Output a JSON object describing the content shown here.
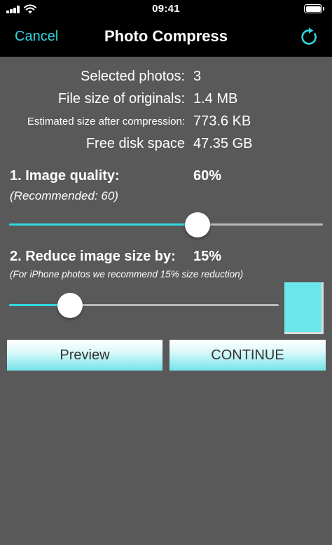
{
  "status_bar": {
    "time": "09:41"
  },
  "nav": {
    "cancel_label": "Cancel",
    "title": "Photo Compress",
    "refresh_icon": "refresh-icon"
  },
  "info": {
    "selected_photos_label": "Selected photos:",
    "selected_photos_value": "3",
    "original_size_label": "File size of originals:",
    "original_size_value": "1.4 MB",
    "estimated_size_label": "Estimated size after compression:",
    "estimated_size_value": "773.6 KB",
    "free_disk_label": "Free disk space",
    "free_disk_value": "47.35 GB"
  },
  "quality": {
    "title": "1. Image quality:",
    "value_label": "60%",
    "note": "(Recommended: 60)",
    "slider_fraction": 0.6
  },
  "reduce": {
    "title": "2. Reduce image size by:",
    "value_label": "15%",
    "note": "(For iPhone photos we recommend 15% size reduction)",
    "slider_fraction": 0.225
  },
  "buttons": {
    "preview_label": "Preview",
    "continue_label": "CONTINUE"
  },
  "colors": {
    "accent": "#31d7df",
    "background": "#595959",
    "nav_background": "#000000",
    "preview_swatch": "#6be6ea"
  }
}
